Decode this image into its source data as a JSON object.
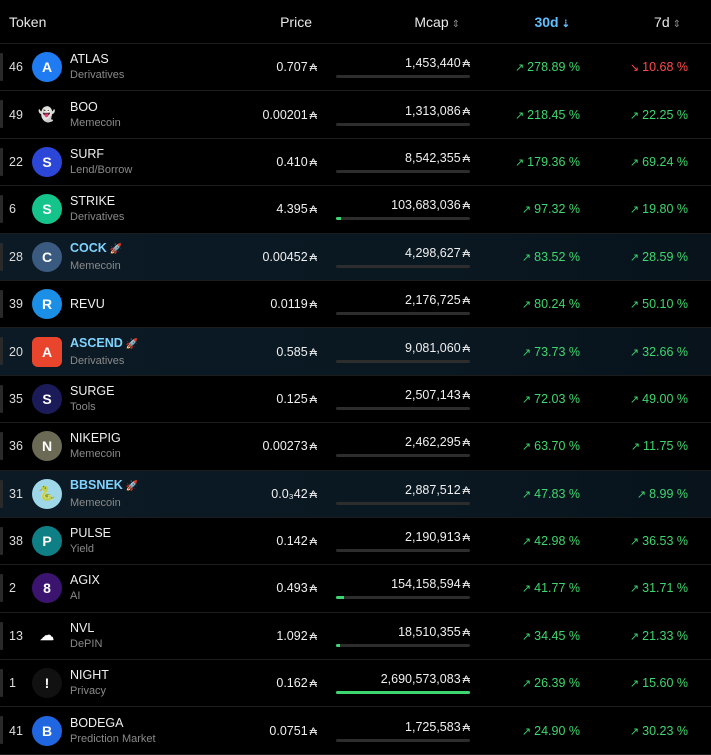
{
  "header": {
    "token": "Token",
    "price": "Price",
    "mcap": "Mcap",
    "d30": "30d",
    "d7": "7d"
  },
  "currency_symbol": "₳",
  "colors": {
    "green": "#3ed66f",
    "red": "#ff4b4b",
    "accent": "#5fc1ff"
  },
  "rows": [
    {
      "rank": "46",
      "name": "ATLAS",
      "cat": "Derivatives",
      "price": "0.707",
      "mcap": "1,453,440",
      "bar": 0.0,
      "p30": "278.89 %",
      "p7": "10.68 %",
      "p7neg": true,
      "boost": false,
      "icon": "atlas-logo-icon",
      "logo_bg": "#1e7bf2",
      "logo_txt": "A"
    },
    {
      "rank": "49",
      "name": "BOO",
      "cat": "Memecoin",
      "price": "0.00201",
      "mcap": "1,313,086",
      "bar": 0.0,
      "p30": "218.45 %",
      "p7": "22.25 %",
      "boost": false,
      "icon": "ghost-logo-icon",
      "logo_bg": "#000",
      "logo_txt": "👻"
    },
    {
      "rank": "22",
      "name": "SURF",
      "cat": "Lend/Borrow",
      "price": "0.410",
      "mcap": "8,542,355",
      "bar": 0.0,
      "p30": "179.36 %",
      "p7": "69.24 %",
      "boost": false,
      "icon": "surf-logo-icon",
      "logo_bg": "#2c47d8",
      "logo_txt": "S"
    },
    {
      "rank": "6",
      "name": "STRIKE",
      "cat": "Derivatives",
      "price": "4.395",
      "mcap": "103,683,036",
      "bar": 0.04,
      "p30": "97.32 %",
      "p7": "19.80 %",
      "boost": false,
      "icon": "strike-logo-icon",
      "logo_bg": "#14c48a",
      "logo_txt": "S"
    },
    {
      "rank": "28",
      "name": "COCK",
      "cat": "Memecoin",
      "price": "0.00452",
      "mcap": "4,298,627",
      "bar": 0.0,
      "p30": "83.52 %",
      "p7": "28.59 %",
      "boost": true,
      "icon": "cock-logo-icon",
      "logo_bg": "#3a5a80",
      "logo_txt": "C"
    },
    {
      "rank": "39",
      "name": "REVU",
      "cat": "",
      "price": "0.0119",
      "mcap": "2,176,725",
      "bar": 0.0,
      "p30": "80.24 %",
      "p7": "50.10 %",
      "boost": false,
      "icon": "revu-logo-icon",
      "logo_bg": "#1b8fe6",
      "logo_txt": "R"
    },
    {
      "rank": "20",
      "name": "ASCEND",
      "cat": "Derivatives",
      "price": "0.585",
      "mcap": "9,081,060",
      "bar": 0.0,
      "p30": "73.73 %",
      "p7": "32.66 %",
      "boost": true,
      "icon": "ascend-logo-icon",
      "logo_bg": "#e8452c",
      "logo_txt": "A",
      "square": true
    },
    {
      "rank": "35",
      "name": "SURGE",
      "cat": "Tools",
      "price": "0.125",
      "mcap": "2,507,143",
      "bar": 0.0,
      "p30": "72.03 %",
      "p7": "49.00 %",
      "boost": false,
      "icon": "surge-logo-icon",
      "logo_bg": "#1b1b5a",
      "logo_txt": "S"
    },
    {
      "rank": "36",
      "name": "NIKEPIG",
      "cat": "Memecoin",
      "price": "0.00273",
      "mcap": "2,462,295",
      "bar": 0.0,
      "p30": "63.70 %",
      "p7": "11.75 %",
      "boost": false,
      "icon": "nikepig-logo-icon",
      "logo_bg": "#6b6a55",
      "logo_txt": "N"
    },
    {
      "rank": "31",
      "name": "BBSNEK",
      "cat": "Memecoin",
      "price": "0.0₃42",
      "mcap": "2,887,512",
      "bar": 0.0,
      "p30": "47.83 %",
      "p7": "8.99 %",
      "boost": true,
      "icon": "bbsnek-logo-icon",
      "logo_bg": "#9ed7e8",
      "logo_txt": "🐍"
    },
    {
      "rank": "38",
      "name": "PULSE",
      "cat": "Yield",
      "price": "0.142",
      "mcap": "2,190,913",
      "bar": 0.0,
      "p30": "42.98 %",
      "p7": "36.53 %",
      "boost": false,
      "icon": "pulse-logo-icon",
      "logo_bg": "#0e7f85",
      "logo_txt": "P"
    },
    {
      "rank": "2",
      "name": "AGIX",
      "cat": "AI",
      "price": "0.493",
      "mcap": "154,158,594",
      "bar": 0.06,
      "p30": "41.77 %",
      "p7": "31.71 %",
      "boost": false,
      "icon": "agix-logo-icon",
      "logo_bg": "#3b1470",
      "logo_txt": "8"
    },
    {
      "rank": "13",
      "name": "NVL",
      "cat": "DePIN",
      "price": "1.092",
      "mcap": "18,510,355",
      "bar": 0.01,
      "p30": "34.45 %",
      "p7": "21.33 %",
      "boost": false,
      "icon": "cloud-logo-icon",
      "logo_bg": "#000",
      "logo_txt": "☁"
    },
    {
      "rank": "1",
      "name": "NIGHT",
      "cat": "Privacy",
      "price": "0.162",
      "mcap": "2,690,573,083",
      "bar": 1.0,
      "p30": "26.39 %",
      "p7": "15.60 %",
      "boost": false,
      "icon": "night-logo-icon",
      "logo_bg": "#111",
      "logo_txt": "!"
    },
    {
      "rank": "41",
      "name": "BODEGA",
      "cat": "Prediction Market",
      "price": "0.0751",
      "mcap": "1,725,583",
      "bar": 0.0,
      "p30": "24.90 %",
      "p7": "30.23 %",
      "boost": false,
      "icon": "bodega-logo-icon",
      "logo_bg": "#1f66e0",
      "logo_txt": "B"
    }
  ]
}
